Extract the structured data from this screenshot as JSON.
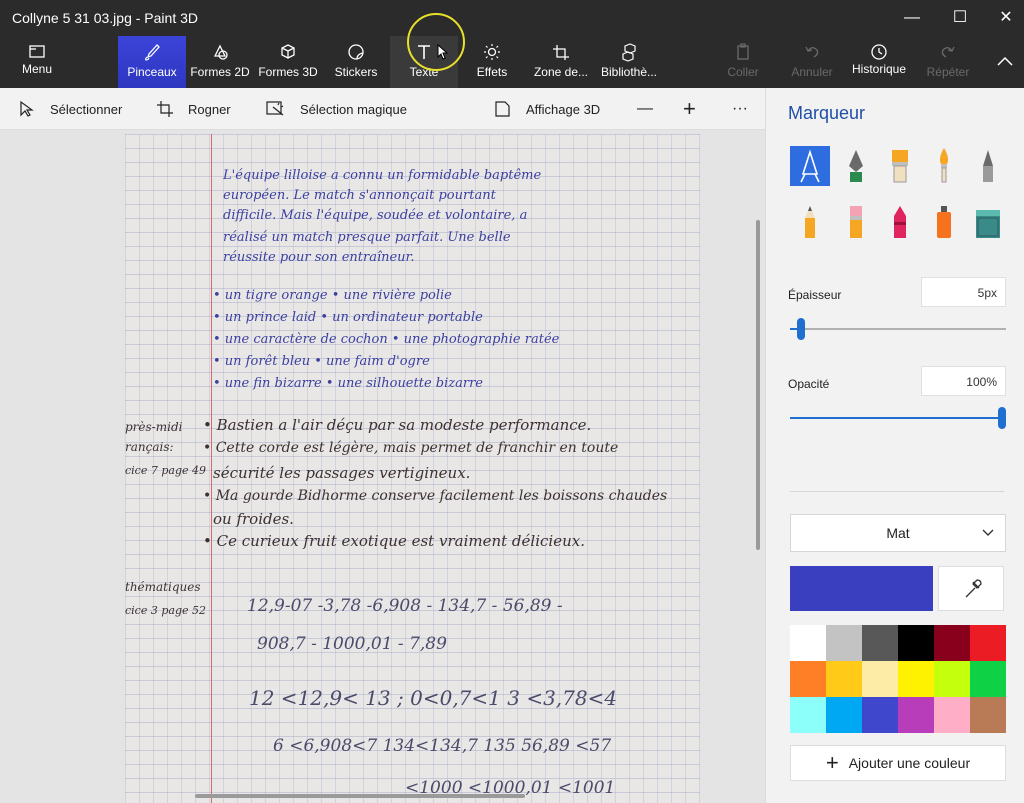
{
  "window": {
    "title": "Collyne 5 31 03.jpg - Paint 3D"
  },
  "ribbon": {
    "menu": "Menu",
    "tools": [
      "Pinceaux",
      "Formes 2D",
      "Formes 3D",
      "Stickers",
      "Texte",
      "Effets",
      "Zone de...",
      "Bibliothè..."
    ],
    "actions": {
      "paste": "Coller",
      "undo": "Annuler",
      "history": "Historique",
      "redo": "Répéter"
    }
  },
  "subtoolbar": {
    "select": "Sélectionner",
    "crop": "Rogner",
    "magic_select": "Sélection magique",
    "view3d": "Affichage 3D",
    "minus": "—",
    "plus": "+",
    "more": "···"
  },
  "panel": {
    "title": "Marqueur",
    "thickness_label": "Épaisseur",
    "thickness_value": "5px",
    "thickness_fraction": 0.05,
    "opacity_label": "Opacité",
    "opacity_value": "100%",
    "opacity_fraction": 1.0,
    "finish": "Mat",
    "current_color": "#3a3fbf",
    "add_color": "Ajouter une couleur",
    "palette": [
      "#ffffff",
      "#c3c3c3",
      "#585858",
      "#000000",
      "#88001b",
      "#ec1c24",
      "#ff7f27",
      "#ffca18",
      "#fdeca6",
      "#fff200",
      "#c4ff0e",
      "#0ed145",
      "#8cfffb",
      "#00a8f3",
      "#3f48cc",
      "#b83dba",
      "#ffaec8",
      "#b97a56"
    ]
  },
  "canvas": {
    "lines": [
      "L'équipe lilloise a connu un formidable baptême",
      "européen. Le match s'annonçait pourtant",
      "difficile. Mais l'équipe, soudée et volontaire, a",
      "réalisé un match presque parfait. Une belle",
      "réussite pour son entraîneur.",
      "• un tigre orange     • une rivière polie",
      "• un prince laid      • un ordinateur portable",
      "• une caractère de cochon  • une photographie ratée",
      "• un forêt bleu       • une faim d'ogre",
      "• une fin bizarre     • une silhouette bizarre",
      "• Bastien a l'air déçu par sa modeste performance.",
      "• Cette corde est légère, mais permet de franchir en toute",
      "sécurité les passages vertigineux.",
      "• Ma gourde Bidhorme conserve facilement les boissons chaudes",
      "ou froides.",
      "• Ce curieux fruit exotique est vraiment délicieux.",
      "12,9-07 -3,78 -6,908 - 134,7 - 56,89 -",
      "908,7 - 1000,01 - 7,89",
      "12 <12,9< 13  ;   0<0,7<1   3 <3,78<4",
      "6 <6,908<7    134<134,7   135 56,89 <57",
      "<1000 <1000,01 <1001"
    ],
    "margin_notes": [
      "près-midi",
      "rançais:",
      "cice 7 page 49",
      "thématiques",
      "cice 3 page 52"
    ]
  }
}
